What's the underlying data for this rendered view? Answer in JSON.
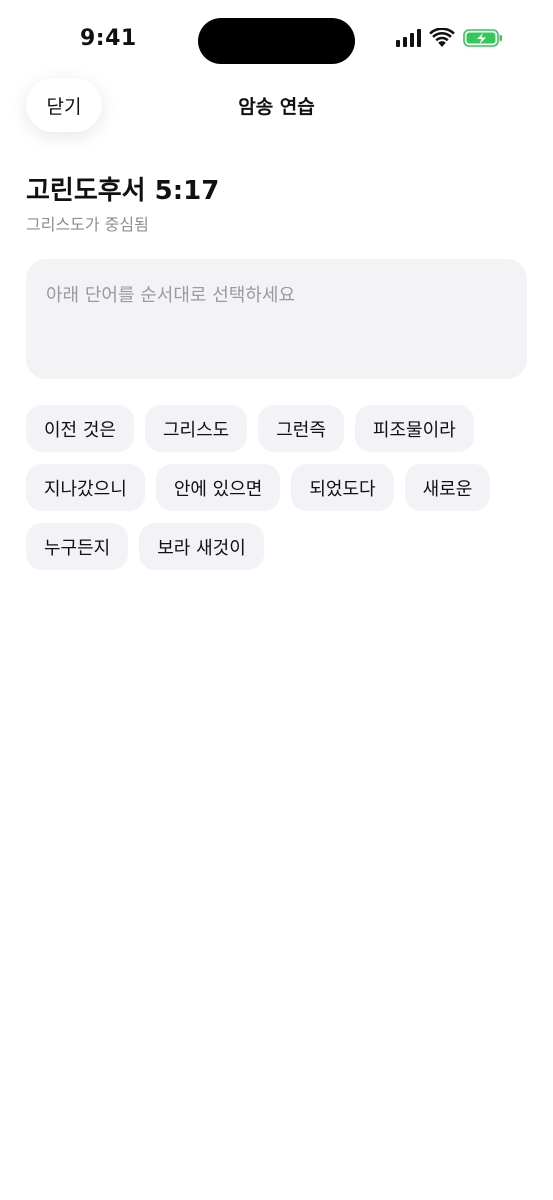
{
  "status_bar": {
    "time": "9:41",
    "battery_color": "#34c759"
  },
  "header": {
    "close_label": "닫기",
    "title": "암송 연습"
  },
  "verse": {
    "reference": "고린도후서 5:17",
    "theme": "그리스도가 중심됨"
  },
  "answer": {
    "placeholder": "아래 단어를 순서대로 선택하세요"
  },
  "words": [
    "이전 것은",
    "그리스도",
    "그런즉",
    "피조물이라",
    "지나갔으니",
    "안에 있으면",
    "되었도다",
    "새로운",
    "누구든지",
    "보라 새것이"
  ]
}
